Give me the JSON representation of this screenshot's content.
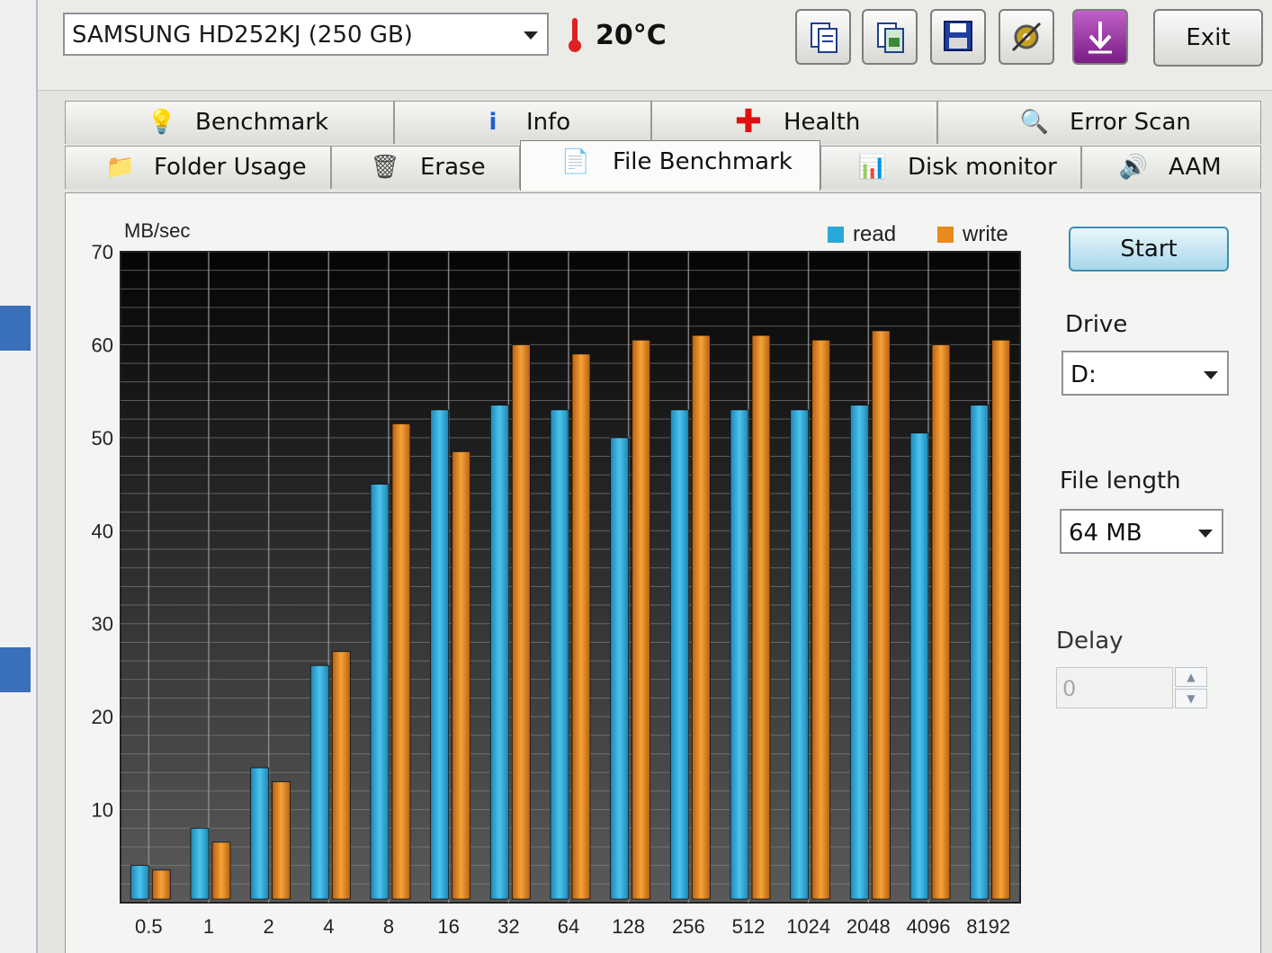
{
  "drive_selector": {
    "value": "SAMSUNG HD252KJ (250 GB)"
  },
  "temperature": "20°C",
  "toolbar": {
    "buttons": [
      {
        "name": "copy-text-icon"
      },
      {
        "name": "copy-image-icon"
      },
      {
        "name": "save-icon"
      },
      {
        "name": "settings-tools-icon"
      },
      {
        "name": "download-arrow-icon"
      }
    ],
    "exit_label": "Exit"
  },
  "tabs_row1": [
    {
      "label": "Benchmark",
      "icon": "lightbulb-icon"
    },
    {
      "label": "Info",
      "icon": "info-icon"
    },
    {
      "label": "Health",
      "icon": "health-cross-icon"
    },
    {
      "label": "Error Scan",
      "icon": "magnifier-icon"
    }
  ],
  "tabs_row2": [
    {
      "label": "Folder Usage",
      "icon": "folder-icon"
    },
    {
      "label": "Erase",
      "icon": "trash-icon"
    },
    {
      "label": "File Benchmark",
      "icon": "file-benchmark-icon",
      "active": true
    },
    {
      "label": "Disk monitor",
      "icon": "bar-chart-icon"
    },
    {
      "label": "AAM",
      "icon": "speaker-icon"
    }
  ],
  "side_panel": {
    "start_label": "Start",
    "drive_label": "Drive",
    "drive_value": "D:",
    "file_length_label": "File length",
    "file_length_value": "64 MB",
    "delay_label": "Delay",
    "delay_value": "0"
  },
  "colors": {
    "read": "#2aa8d8",
    "write": "#e88a1e",
    "plot_bg_top": "#050505",
    "plot_bg_bottom": "#5a5a5a"
  },
  "chart_data": {
    "type": "bar",
    "ylabel": "MB/sec",
    "ylim": [
      0,
      70
    ],
    "yticks": [
      10,
      20,
      30,
      40,
      50,
      60,
      70
    ],
    "categories": [
      "0.5",
      "1",
      "2",
      "4",
      "8",
      "16",
      "32",
      "64",
      "128",
      "256",
      "512",
      "1024",
      "2048",
      "4096",
      "8192"
    ],
    "series": [
      {
        "name": "read",
        "values": [
          4,
          8,
          14.5,
          25.5,
          45,
          53,
          53.5,
          53,
          50,
          53,
          53,
          53,
          53.5,
          50.5,
          53.5
        ]
      },
      {
        "name": "write",
        "values": [
          3.5,
          6.5,
          13,
          27,
          51.5,
          48.5,
          60,
          59,
          60.5,
          61,
          61,
          60.5,
          61.5,
          60,
          60.5
        ]
      }
    ],
    "legend_position": "top-right",
    "grid": true
  }
}
